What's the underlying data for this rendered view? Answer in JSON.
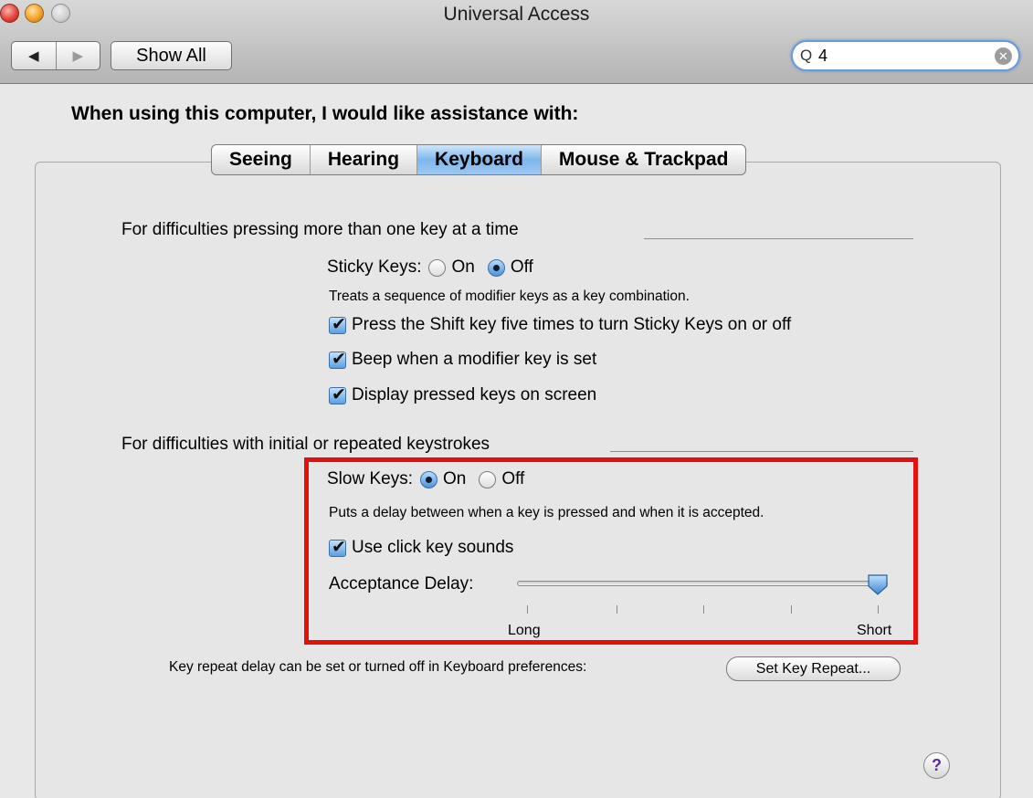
{
  "window": {
    "title": "Universal Access",
    "show_all_label": "Show All",
    "back_glyph": "◀",
    "forward_glyph": "▶",
    "search": {
      "value": "4",
      "mag_glyph": "Q",
      "clear_glyph": "✕"
    }
  },
  "heading": "When using this computer, I would like assistance with:",
  "tabs": [
    {
      "label": "Seeing",
      "selected": false
    },
    {
      "label": "Hearing",
      "selected": false
    },
    {
      "label": "Keyboard",
      "selected": true
    },
    {
      "label": "Mouse & Trackpad",
      "selected": false
    }
  ],
  "section1": {
    "title": "For difficulties pressing more than one key at a time",
    "sticky_keys": {
      "label": "Sticky Keys:",
      "on_label": "On",
      "off_label": "Off",
      "selected": "Off",
      "description": "Treats a sequence of modifier keys as a key combination."
    },
    "checkboxes": [
      {
        "label": "Press the Shift key five times to turn Sticky Keys on or off",
        "checked": true
      },
      {
        "label": "Beep when a modifier key is set",
        "checked": true
      },
      {
        "label": "Display pressed keys on screen",
        "checked": true
      }
    ]
  },
  "section2": {
    "title": "For difficulties with initial or repeated keystrokes",
    "slow_keys": {
      "label": "Slow Keys:",
      "on_label": "On",
      "off_label": "Off",
      "selected": "On",
      "description": "Puts a delay between when a key is pressed and when it is accepted."
    },
    "click_sounds": {
      "label": "Use click key sounds",
      "checked": true
    },
    "acceptance_delay": {
      "label": "Acceptance Delay:",
      "min_label": "Long",
      "max_label": "Short",
      "value_fraction": 1.0
    }
  },
  "key_repeat": {
    "text": "Key repeat delay can be set or turned off in Keyboard preferences:",
    "button_label": "Set Key Repeat..."
  },
  "help_glyph": "?",
  "colors": {
    "highlight_box": "#e41010",
    "selected_tab": "#7fb6ec",
    "search_focus": "#6a9bd8"
  }
}
